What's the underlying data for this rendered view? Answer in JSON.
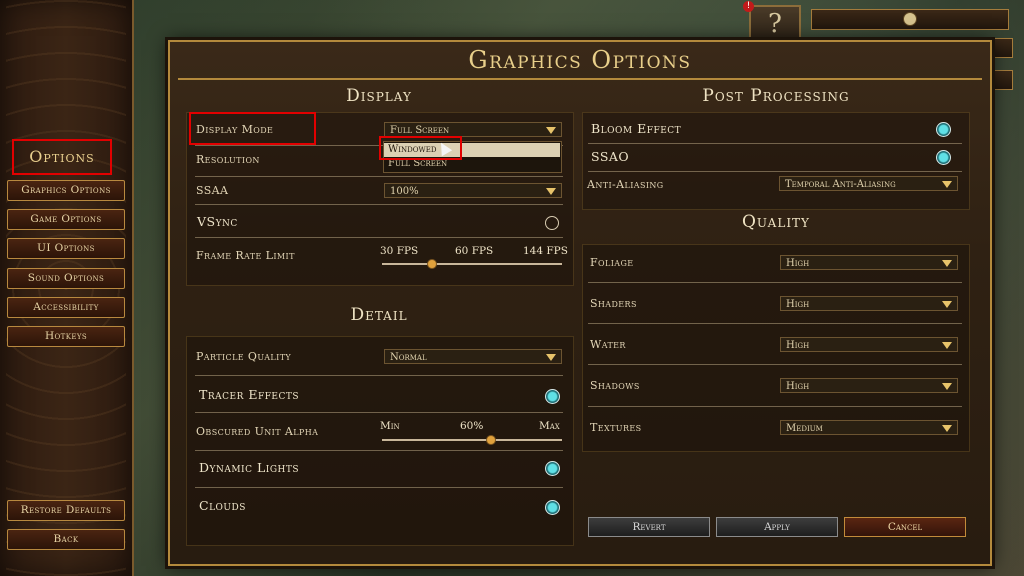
{
  "sidebar": {
    "title": "Options",
    "items": [
      {
        "label": "Graphics Options"
      },
      {
        "label": "Game Options"
      },
      {
        "label": "UI Options"
      },
      {
        "label": "Sound Options"
      },
      {
        "label": "Accessibility"
      },
      {
        "label": "Hotkeys"
      }
    ],
    "restore_label": "Restore Defaults",
    "back_label": "Back"
  },
  "hud": {
    "help_glyph": "?",
    "alert_glyph": "!"
  },
  "panel": {
    "title": "Graphics Options"
  },
  "display": {
    "title": "Display",
    "display_mode": {
      "label": "Display Mode",
      "value": "Full Screen",
      "options": [
        "Windowed",
        "Full Screen"
      ]
    },
    "resolution": {
      "label": "Resolution"
    },
    "ssaa": {
      "label": "SSAA",
      "value": "100%"
    },
    "vsync": {
      "label": "VSync",
      "enabled": false
    },
    "frame_rate": {
      "label": "Frame Rate Limit",
      "min": "30 FPS",
      "value": "60 FPS",
      "max": "144 FPS",
      "fraction": 0.27
    }
  },
  "detail": {
    "title": "Detail",
    "particle_quality": {
      "label": "Particle Quality",
      "value": "Normal"
    },
    "tracer_effects": {
      "label": "Tracer Effects",
      "enabled": true
    },
    "obscured_alpha": {
      "label": "Obscured Unit Alpha",
      "min": "Min",
      "value": "60%",
      "max": "Max",
      "fraction": 0.6
    },
    "dynamic_lights": {
      "label": "Dynamic Lights",
      "enabled": true
    },
    "clouds": {
      "label": "Clouds",
      "enabled": true
    }
  },
  "post": {
    "title": "Post Processing",
    "bloom": {
      "label": "Bloom Effect",
      "enabled": true
    },
    "ssao": {
      "label": "SSAO",
      "enabled": true
    },
    "aa": {
      "label": "Anti-Aliasing",
      "value": "Temporal Anti-Aliasing"
    }
  },
  "quality": {
    "title": "Quality",
    "items": [
      {
        "label": "Foliage",
        "value": "High"
      },
      {
        "label": "Shaders",
        "value": "High"
      },
      {
        "label": "Water",
        "value": "High"
      },
      {
        "label": "Shadows",
        "value": "High"
      },
      {
        "label": "Textures",
        "value": "Medium"
      }
    ]
  },
  "footer": {
    "revert": "Revert",
    "apply": "Apply",
    "cancel": "Cancel"
  },
  "colors": {
    "accent": "#b48a3c",
    "toggle_on": "#5fe0e6",
    "highlight": "#e20000"
  }
}
